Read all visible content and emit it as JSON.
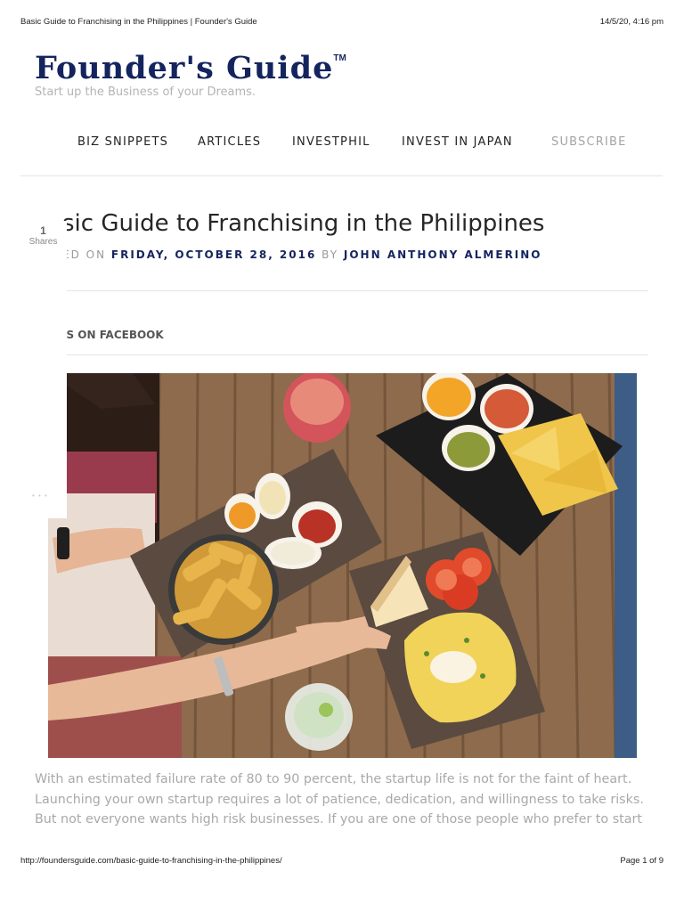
{
  "print_header": {
    "title": "Basic Guide to Franchising in the Philippines | Founder's Guide",
    "datetime": "14/5/20, 4:16 pm"
  },
  "site": {
    "name": "Founder's Guide",
    "trademark": "TM",
    "tagline": "Start up the Business of your Dreams.",
    "brand_color": "#14245e"
  },
  "nav": {
    "items": [
      "BIZ SNIPPETS",
      "ARTICLES",
      "INVESTPHIL",
      "INVEST IN JAPAN",
      "SUBSCRIBE"
    ]
  },
  "share": {
    "count": "1",
    "label": "Shares"
  },
  "post": {
    "title": "sic Guide to Franchising in the Philippines",
    "meta_prefix": "ED ON",
    "date": "FRIDAY, OCTOBER 28, 2016",
    "by": "BY",
    "author": "JOHN ANTHONY ALMERINO",
    "facebook_link": "JS ON FACEBOOK",
    "body": "With an estimated failure rate of 80 to 90 percent, the startup life is not for the faint of heart. Launching your own startup requires a lot of patience, dedication, and willingness to take risks. But not everyone wants high risk businesses. If you are one of those people who prefer to start small with"
  },
  "print_footer": {
    "url": "http://foundersguide.com/basic-guide-to-franchising-in-the-philippines/",
    "page": "Page 1 of 9"
  }
}
